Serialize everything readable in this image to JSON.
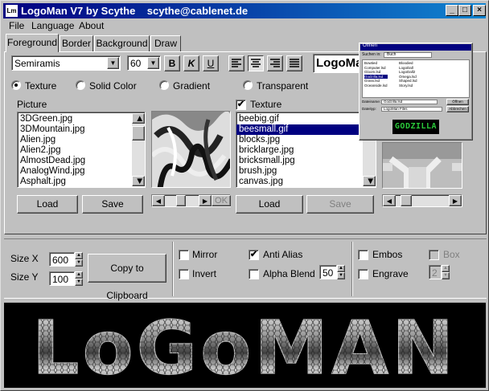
{
  "window": {
    "title": "LogoMan V7 by Scythe    scythe@cablenet.de",
    "minimize": "_",
    "maximize": "□",
    "close": "×",
    "app_icon": "Lm"
  },
  "menu": [
    "File",
    "Language",
    "About"
  ],
  "tabs": [
    "Foreground",
    "Border",
    "Background",
    "Draw"
  ],
  "font": {
    "name": "Semiramis",
    "size": "60",
    "bold": "B",
    "italic": "K",
    "underline": "U",
    "preview_text": "LogoMan"
  },
  "fill_modes": {
    "texture": "Texture",
    "solid": "Solid Color",
    "gradient": "Gradient",
    "transparent": "Transparent",
    "selected": "texture"
  },
  "picture": {
    "label": "Picture",
    "files": [
      "3DGreen.jpg",
      "3DMountain.jpg",
      "Alien.jpg",
      "Alien2.jpg",
      "AlmostDead.jpg",
      "AnalogWind.jpg",
      "Asphalt.jpg"
    ],
    "load": "Load",
    "save": "Save"
  },
  "texture": {
    "label": "Texture",
    "checked": true,
    "files": [
      "beebig.gif",
      "beesmall.gif",
      "blocks.jpg",
      "bricklarge.jpg",
      "bricksmall.jpg",
      "brush.jpg",
      "canvas.jpg"
    ],
    "selected": "beesmall.gif",
    "load": "Load",
    "save": "Save"
  },
  "ok_label": "OK",
  "size": {
    "x_label": "Size X",
    "y_label": "Size Y",
    "x": "600",
    "y": "100",
    "copy": "Copy to Clipboard"
  },
  "options": {
    "mirror": {
      "label": "Mirror",
      "checked": false
    },
    "invert": {
      "label": "Invert",
      "checked": false
    },
    "anti_alias": {
      "label": "Anti Alias",
      "checked": true
    },
    "alpha_blend": {
      "label": "Alpha Blend",
      "checked": false,
      "value": "50"
    },
    "embos": {
      "label": "Embos",
      "checked": false
    },
    "engrave": {
      "label": "Engrave",
      "checked": false
    },
    "box": {
      "label": "Box",
      "checked": false,
      "value": "2"
    }
  },
  "logo_text": "LoGoMAN",
  "mini_dialog": {
    "title": "Öffnen",
    "search_label": "Suchen in:",
    "folder": "Buch",
    "filename_label": "Dateiname:",
    "filetype_label": "Dateityp:",
    "filename": "Godzilla.lsd",
    "filetype": "LogoMan Files",
    "open": "Öffnen",
    "cancel": "Abbrechen",
    "files": [
      "Bowtied",
      "Computer.lsd",
      "Gloom.lsd",
      "Godzilla.lsd",
      "Grass.lsd",
      "Oceanside.lsd",
      "Bloodied",
      "LogoDall",
      "LogoDall2",
      "Omega.lsd",
      "Shaped.lsd",
      "Story.lsd"
    ],
    "preview": "GODZILLA"
  },
  "icons": {
    "check": "✔",
    "arrow_down": "▼",
    "arrow_up": "▲",
    "arrow_left": "◀",
    "arrow_right": "▶"
  },
  "colors": {
    "title_start": "#000080",
    "title_end": "#1084d0",
    "selection": "#000080",
    "logo_bg": "#000000"
  }
}
